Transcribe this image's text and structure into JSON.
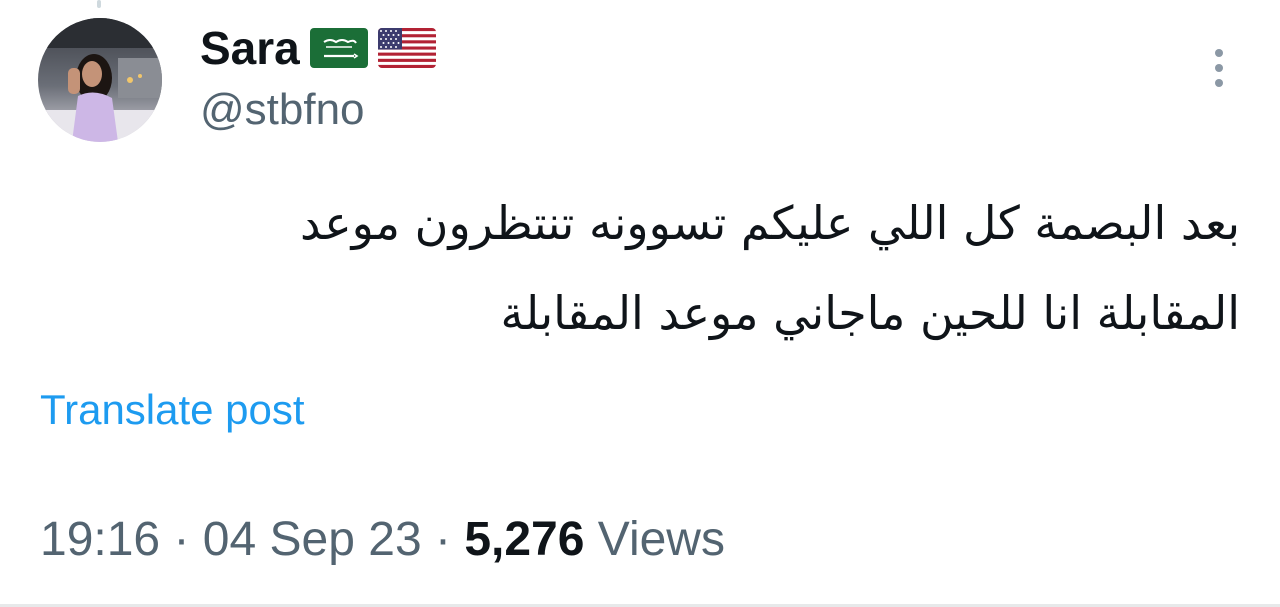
{
  "tweet": {
    "display_name": "Sara",
    "flags": [
      "saudi-arabia-flag-icon",
      "usa-flag-icon"
    ],
    "handle": "@stbfno",
    "text_line1": "بعد البصمة كل اللي عليكم تسوونه تنتظرون موعد",
    "text_line2": "المقابلة انا للحين ماجاني موعد المقابلة",
    "translate_label": "Translate post",
    "time": "19:16",
    "separator": "·",
    "date": "04 Sep 23",
    "views_count": "5,276",
    "views_label": "Views"
  },
  "colors": {
    "text_primary": "#0f1419",
    "text_secondary": "#536471",
    "link": "#1d9bf0",
    "saudi_green": "#1b6e37",
    "usa_red": "#b22234",
    "usa_blue": "#3c3b6e"
  }
}
